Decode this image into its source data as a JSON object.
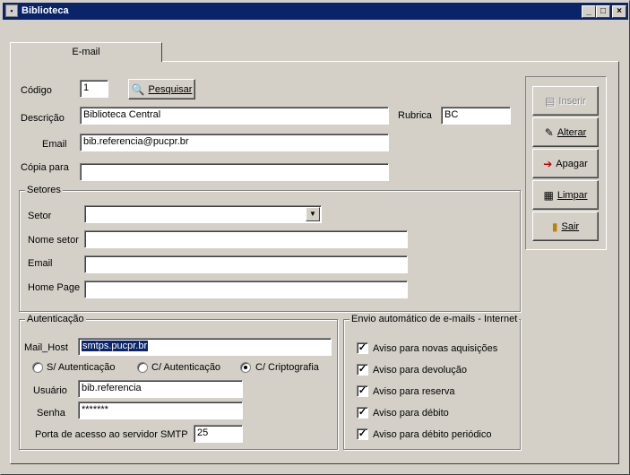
{
  "window": {
    "title": "Biblioteca",
    "minimize": "_",
    "maximize": "□",
    "close": "×"
  },
  "tab": {
    "label": "E-mail"
  },
  "form": {
    "codigo_label": "Código",
    "codigo_value": "1",
    "pesquisar_label": "Pesquisar",
    "descricao_label": "Descrição",
    "descricao_value": "Biblioteca Central",
    "rubrica_label": "Rubrica",
    "rubrica_value": "BC",
    "email_label": "Email",
    "email_value": "bib.referencia@pucpr.br",
    "copia_label": "Cópia para",
    "copia_value": ""
  },
  "setores": {
    "title": "Setores",
    "setor_label": "Setor",
    "setor_value": "",
    "nome_label": "Nome setor",
    "nome_value": "",
    "email_label": "Email",
    "email_value": "",
    "homepage_label": "Home Page",
    "homepage_value": ""
  },
  "autenticacao": {
    "title": "Autenticação",
    "mailhost_label": "Mail_Host",
    "mailhost_value": "smtps.pucpr.br",
    "radio_none": "S/ Autenticação",
    "radio_auth": "C/ Autenticação",
    "radio_crypto": "C/ Criptografia",
    "selected": "crypto",
    "usuario_label": "Usuário",
    "usuario_value": "bib.referencia",
    "senha_label": "Senha",
    "senha_value": "*******",
    "porta_label": "Porta de acesso ao servidor SMTP",
    "porta_value": "25"
  },
  "envio": {
    "title": "Envio automático de e-mails - Internet",
    "items": [
      {
        "label": "Aviso para novas aquisições",
        "checked": true
      },
      {
        "label": "Aviso para devolução",
        "checked": true
      },
      {
        "label": "Aviso para reserva",
        "checked": true
      },
      {
        "label": "Aviso para débito",
        "checked": true
      },
      {
        "label": "Aviso para débito periódico",
        "checked": true
      }
    ]
  },
  "actions": {
    "inserir": "Inserir",
    "alterar": "Alterar",
    "apagar": "Apagar",
    "limpar": "Limpar",
    "sair": "Sair"
  }
}
